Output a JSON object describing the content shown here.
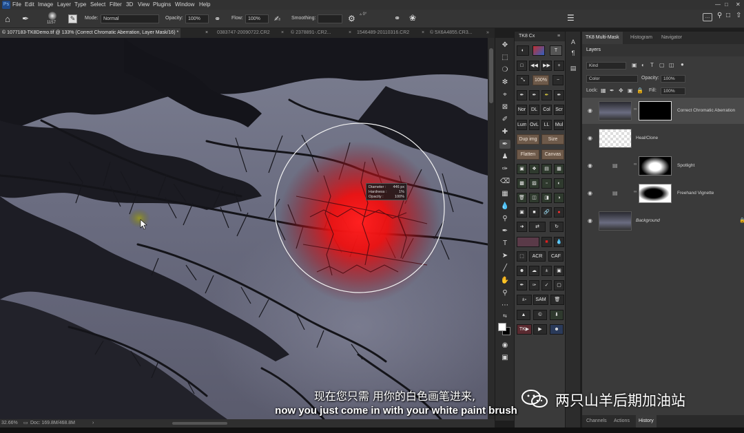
{
  "menu": [
    "File",
    "Edit",
    "Image",
    "Layer",
    "Type",
    "Select",
    "Filter",
    "3D",
    "View",
    "Plugins",
    "Window",
    "Help"
  ],
  "ps_logo": "Ps",
  "options": {
    "brush_size": "1157",
    "mode_label": "Mode:",
    "mode_value": "Normal",
    "opacity_label": "Opacity:",
    "opacity_value": "100%",
    "flow_label": "Flow:",
    "flow_value": "100%",
    "smoothing_label": "Smoothing:",
    "smoothing_value": ""
  },
  "tabs": [
    {
      "label": "© 1077183-TK8Demo.tif @ 133% (Correct Chromatic Aberration, Layer Mask/16) *",
      "active": true
    },
    {
      "label": "0383747-20090722.CR2",
      "active": false
    },
    {
      "label": "© 2378891-.CR2...",
      "active": false
    },
    {
      "label": "1546489-20110316.CR2",
      "active": false
    },
    {
      "label": "© 5X6A4855.CR3...",
      "active": false
    }
  ],
  "status": {
    "zoom": "32.66%",
    "doc": "Doc: 169.8M/468.8M"
  },
  "hud": {
    "diameter_label": "Diameter :",
    "diameter_value": "446 px",
    "hardness_label": "Hardness :",
    "hardness_value": "1%",
    "opacity_label": "Opacity :",
    "opacity_value": "100%"
  },
  "tk8cx": {
    "title": "TK8 Cx",
    "buttons": {
      "zoom": "100%",
      "nor": "Nor",
      "dl": "DL",
      "col": "Col",
      "scr": "Scr",
      "lum": "Lum",
      "ovl": "OvL",
      "ll": "LL",
      "mul": "Mul",
      "dup_img": "Dup img",
      "size": "Size",
      "flatten": "Flatten",
      "canvas": "Canvas",
      "acr": "ACR",
      "caf": "CAF",
      "sam": "SAM",
      "tk": "TK▶"
    }
  },
  "right_panel": {
    "tabs": [
      "TK8 Multi-Mask",
      "Histogram",
      "Navigator"
    ],
    "layers_tab": "Layers",
    "kind": "Kind",
    "blend_mode": "Color",
    "opacity_label": "Opacity:",
    "opacity_value": "100%",
    "lock_label": "Lock:",
    "fill_label": "Fill:",
    "fill_value": "100%",
    "layers": [
      {
        "name": "Correct Chromatic Aberration"
      },
      {
        "name": "Heal/Clone"
      },
      {
        "name": "Spotlight"
      },
      {
        "name": "Freehand Vignette"
      },
      {
        "name": "Background"
      }
    ],
    "bottom_tabs": [
      "Channels",
      "Actions",
      "History"
    ]
  },
  "subtitles": {
    "cn": "现在您只需 用你的白色画笔进来,",
    "en": "now you just come in with your white paint brush"
  },
  "watermark": "两只山羊后期加油站",
  "colors": {
    "brush_glow": "#ff1a1a",
    "panel_bg": "#3a3a3a",
    "tan_button": "#6e5a4a"
  }
}
